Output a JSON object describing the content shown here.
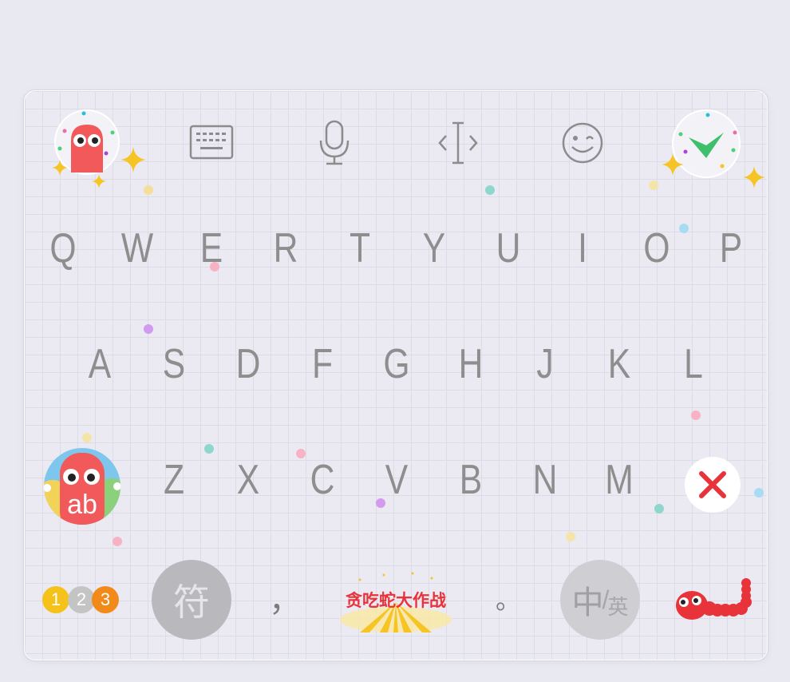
{
  "keyboard": {
    "row1": [
      "Q",
      "W",
      "E",
      "R",
      "T",
      "Y",
      "U",
      "I",
      "O",
      "P"
    ],
    "row2": [
      "A",
      "S",
      "D",
      "F",
      "G",
      "H",
      "J",
      "K",
      "L"
    ],
    "row3": [
      "Z",
      "X",
      "C",
      "V",
      "B",
      "N",
      "M"
    ],
    "shift_label": "ab",
    "numbers": [
      "1",
      "2",
      "3"
    ],
    "symbols_label": "符",
    "comma": "，",
    "period": "。",
    "space_banner": "贪吃蛇大作战",
    "lang_primary": "中",
    "lang_secondary": "英"
  },
  "toolbar": {
    "icons": [
      "snake-avatar-icon",
      "keyboard-icon",
      "microphone-icon",
      "cursor-icon",
      "emoji-icon",
      "checkmark-icon"
    ]
  },
  "colors": {
    "key_text": "#8e8e8e",
    "snake_red": "#f2595b",
    "check_green": "#3fbf6b",
    "delete_red": "#e8333a",
    "coin_yellow": "#f4c21a",
    "coin_gray": "#c4c4c4",
    "coin_orange": "#f28a1a"
  }
}
